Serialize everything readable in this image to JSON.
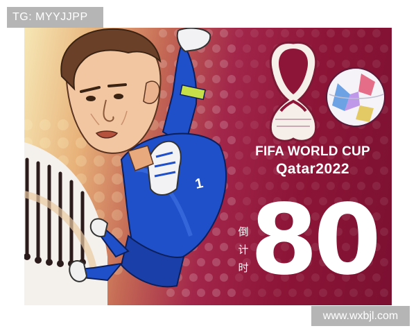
{
  "watermarks": {
    "top": "TG: MYYJJPP",
    "bottom": "www.wxbjl.com"
  },
  "poster": {
    "event_title": "FIFA WORLD CUP",
    "event_subtitle": "Qatar2022",
    "countdown_label": "倒\n计\n时",
    "countdown_number": "80",
    "jersey_number": "1",
    "colors": {
      "background_dark": "#8d1537",
      "background_light": "#f6e7b5",
      "kit_blue": "#1f4fc9",
      "text": "#ffffff"
    },
    "icons": [
      "world-cup-emblem",
      "match-ball",
      "goalkeeper-illustration"
    ]
  }
}
